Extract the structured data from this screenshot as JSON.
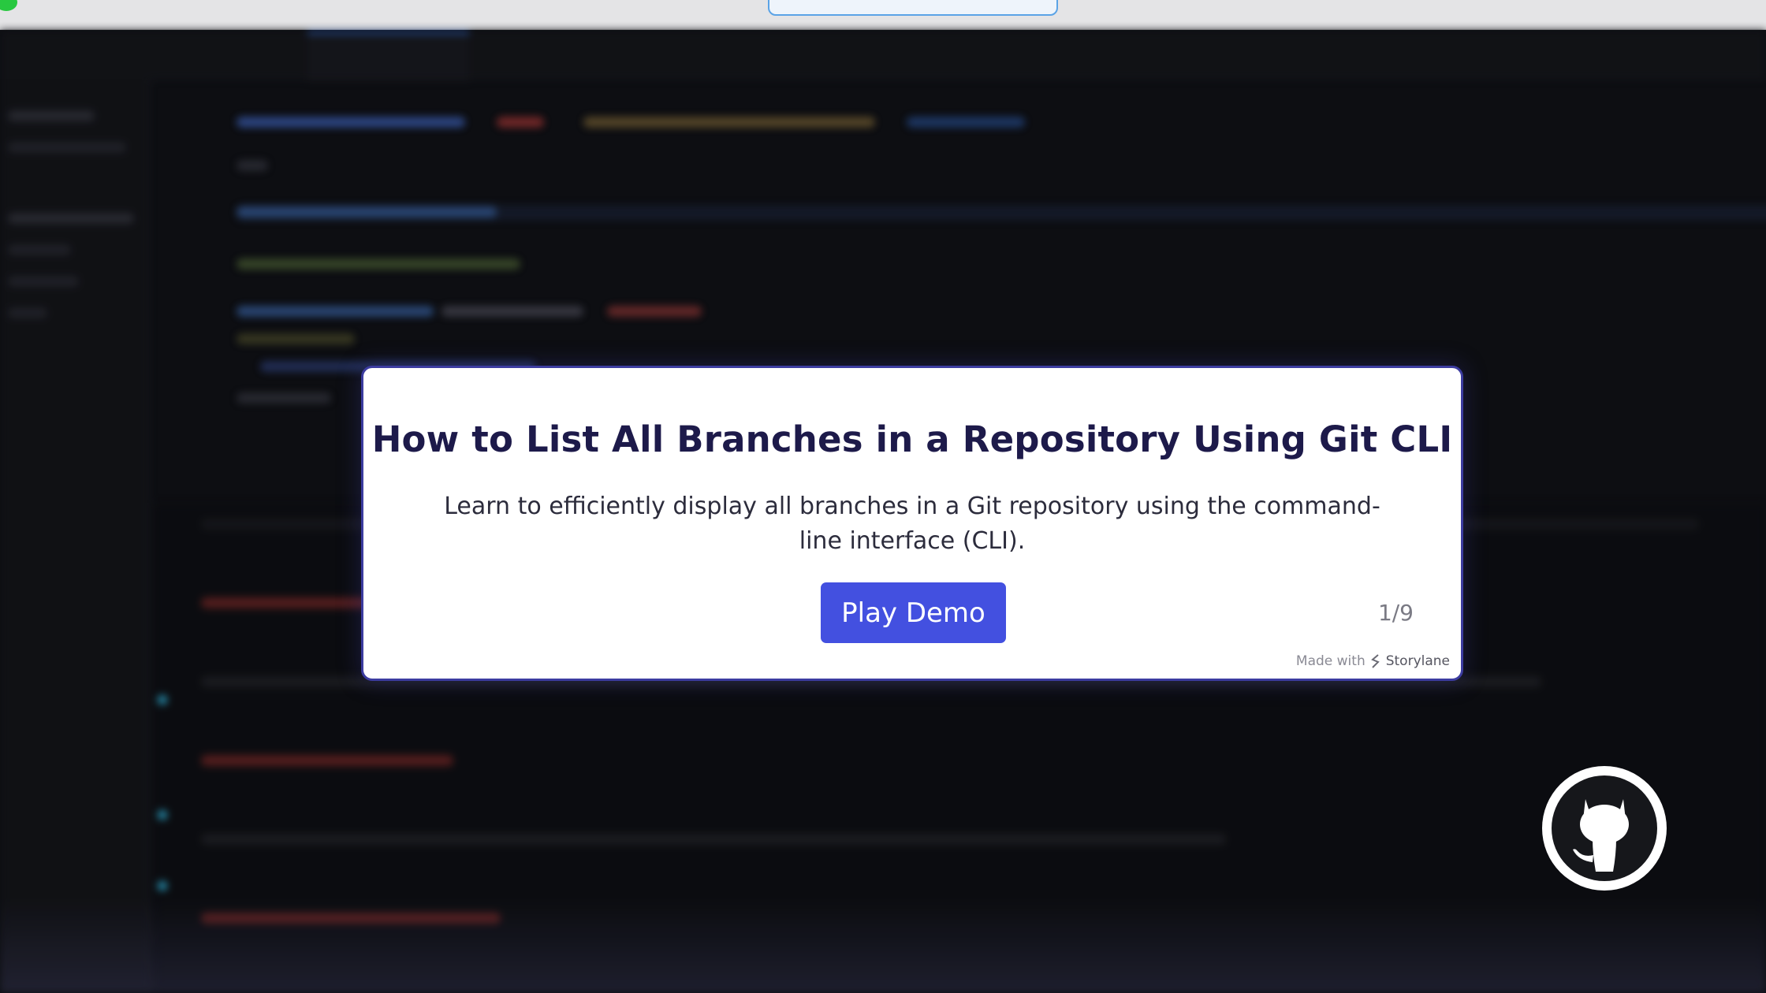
{
  "modal": {
    "title": "How to List All Branches in a Repository Using Git CLI",
    "description": "Learn to efficiently display all branches in a Git repository using the command-line interface (CLI).",
    "play_label": "Play Demo",
    "step_counter": "1/9",
    "made_with_prefix": "Made with",
    "made_with_brand": "Storylane"
  },
  "icons": {
    "github": "github-octocat-icon",
    "storylane": "storylane-logo-icon"
  },
  "colors": {
    "accent": "#4350e0",
    "title": "#1d1a4a",
    "modal_border": "#3c3ca0",
    "background": "#0d0e12"
  }
}
